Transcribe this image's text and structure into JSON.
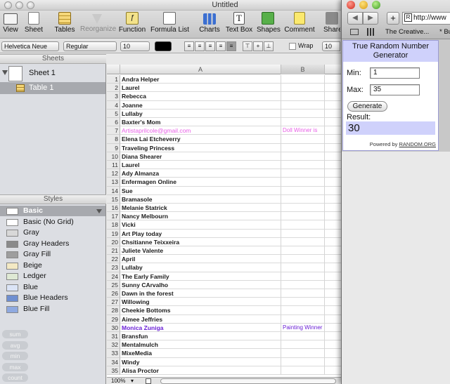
{
  "numbers": {
    "window_title": "Untitled",
    "toolbar": [
      {
        "label": "View",
        "icon": "view-icon",
        "dim": false
      },
      {
        "label": "Sheet",
        "icon": "sheet-icon",
        "dim": false
      },
      {
        "label": "Tables",
        "icon": "tables-icon",
        "dim": false
      },
      {
        "label": "Reorganize",
        "icon": "reorganize-icon",
        "dim": true
      },
      {
        "label": "Function",
        "icon": "function-icon",
        "dim": false
      },
      {
        "label": "Formula List",
        "icon": "formula-list-icon",
        "dim": false
      },
      {
        "label": "Charts",
        "icon": "charts-icon",
        "dim": false
      },
      {
        "label": "Text Box",
        "icon": "text-box-icon",
        "dim": false
      },
      {
        "label": "Shapes",
        "icon": "shapes-icon",
        "dim": false
      },
      {
        "label": "Comment",
        "icon": "comment-icon",
        "dim": false
      },
      {
        "label": "Share",
        "icon": "share-icon",
        "dim": false
      }
    ],
    "format_bar": {
      "font_family": "Helvetica Neue",
      "font_style": "Regular",
      "font_size": "10",
      "wrap_label": "Wrap",
      "size_right": "10"
    },
    "sidebar": {
      "sheets_header": "Sheets",
      "sheet_name": "Sheet 1",
      "table_name": "Table 1",
      "styles_header": "Styles",
      "styles": [
        {
          "name": "Basic",
          "swatch": "#ffffff",
          "selected": true
        },
        {
          "name": "Basic (No Grid)",
          "swatch": "#ffffff",
          "selected": false
        },
        {
          "name": "Gray",
          "swatch": "#d8d8d8",
          "selected": false
        },
        {
          "name": "Gray Headers",
          "swatch": "#8a8a8a",
          "selected": false
        },
        {
          "name": "Gray Fill",
          "swatch": "#9e9e9e",
          "selected": false
        },
        {
          "name": "Beige",
          "swatch": "#f3e9c4",
          "selected": false
        },
        {
          "name": "Ledger",
          "swatch": "#dfe9d4",
          "selected": false
        },
        {
          "name": "Blue",
          "swatch": "#dbe4f6",
          "selected": false
        },
        {
          "name": "Blue Headers",
          "swatch": "#6f8fd0",
          "selected": false
        },
        {
          "name": "Blue Fill",
          "swatch": "#8fa9e0",
          "selected": false
        }
      ],
      "functions": [
        "sum",
        "avg",
        "min",
        "max",
        "count"
      ]
    },
    "grid": {
      "columns": [
        "A",
        "B"
      ],
      "rows": [
        {
          "n": "1",
          "a": "Andra Helper",
          "b": ""
        },
        {
          "n": "2",
          "a": "Laurel",
          "b": ""
        },
        {
          "n": "3",
          "a": "Rebecca",
          "b": ""
        },
        {
          "n": "4",
          "a": "Joanne",
          "b": ""
        },
        {
          "n": "5",
          "a": "Lullaby",
          "b": ""
        },
        {
          "n": "6",
          "a": "Baxter's Mom",
          "b": ""
        },
        {
          "n": "7",
          "a": "Artistaprilcole@gmail.com",
          "b": "Doll Winner is",
          "color": "#e85fe6"
        },
        {
          "n": "8",
          "a": "Elena Lai Etcheverry",
          "b": ""
        },
        {
          "n": "9",
          "a": "Traveling Princess",
          "b": ""
        },
        {
          "n": "10",
          "a": "Diana Shearer",
          "b": ""
        },
        {
          "n": "11",
          "a": "Laurel",
          "b": ""
        },
        {
          "n": "12",
          "a": "Ady Almanza",
          "b": ""
        },
        {
          "n": "13",
          "a": "Enfermagen Online",
          "b": ""
        },
        {
          "n": "14",
          "a": "Sue",
          "b": ""
        },
        {
          "n": "15",
          "a": "Bramasole",
          "b": ""
        },
        {
          "n": "16",
          "a": "Melanie Statrick",
          "b": ""
        },
        {
          "n": "17",
          "a": "Nancy Melbourn",
          "b": ""
        },
        {
          "n": "18",
          "a": "Vicki",
          "b": ""
        },
        {
          "n": "19",
          "a": "Art Play today",
          "b": ""
        },
        {
          "n": "20",
          "a": "Chsitianne Teixxeira",
          "b": ""
        },
        {
          "n": "21",
          "a": "Juliete Valente",
          "b": ""
        },
        {
          "n": "22",
          "a": "April",
          "b": ""
        },
        {
          "n": "23",
          "a": "Lullaby",
          "b": ""
        },
        {
          "n": "24",
          "a": "The Early Family",
          "b": ""
        },
        {
          "n": "25",
          "a": "Sunny CArvalho",
          "b": ""
        },
        {
          "n": "26",
          "a": "Dawn in the forest",
          "b": ""
        },
        {
          "n": "27",
          "a": "Willowing",
          "b": ""
        },
        {
          "n": "28",
          "a": "Cheekie Bottoms",
          "b": ""
        },
        {
          "n": "29",
          "a": "Aimee Jeffries",
          "b": ""
        },
        {
          "n": "30",
          "a": "Monica Zuniga",
          "b": "Painting Winner is",
          "color": "#6a1fd6"
        },
        {
          "n": "31",
          "a": "Bransfun",
          "b": ""
        },
        {
          "n": "32",
          "a": "Mentalmulch",
          "b": ""
        },
        {
          "n": "33",
          "a": "MixeMedia",
          "b": ""
        },
        {
          "n": "34",
          "a": "Windy",
          "b": ""
        },
        {
          "n": "35",
          "a": "Alisa Proctor",
          "b": ""
        }
      ]
    },
    "status": {
      "zoom": "100%"
    }
  },
  "browser": {
    "address": "http://www",
    "bookmark": "The Creative...",
    "bookmark_more": "Bu",
    "widget": {
      "title": "True Random Number Generator",
      "min_label": "Min:",
      "min_value": "1",
      "max_label": "Max:",
      "max_value": "35",
      "button": "Generate",
      "result_label": "Result:",
      "result_value": "30",
      "powered_by": "Powered by",
      "powered_link": "RANDOM.ORG"
    }
  }
}
